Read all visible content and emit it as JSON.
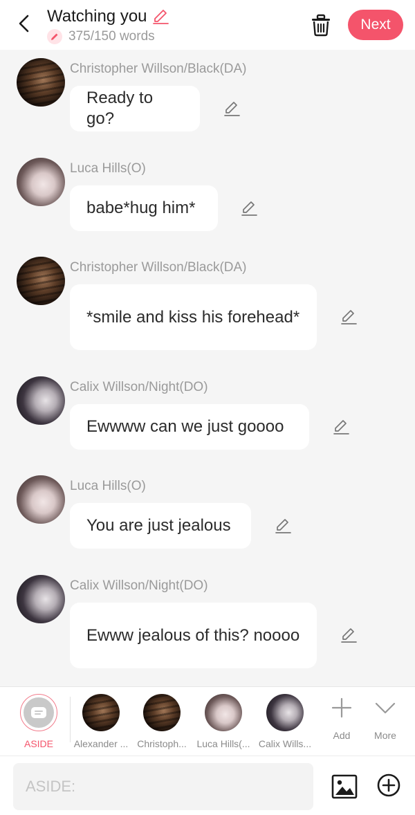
{
  "header": {
    "title": "Watching you",
    "word_count": "375/150 words",
    "next_label": "Next",
    "accent_color": "#f4546b"
  },
  "messages": [
    {
      "name": "Christopher Willson/Black(DA)",
      "text": "Ready to go?",
      "avatar": "christopher"
    },
    {
      "name": "Luca Hills(O)",
      "text": "babe*hug him*",
      "avatar": "luca"
    },
    {
      "name": "Christopher Willson/Black(DA)",
      "text": "*smile and kiss his forehead*",
      "avatar": "christopher"
    },
    {
      "name": "Calix Willson/Night(DO)",
      "text": "Ewwww can we just goooo",
      "avatar": "calix"
    },
    {
      "name": "Luca Hills(O)",
      "text": "You are just jealous",
      "avatar": "luca"
    },
    {
      "name": "Calix Willson/Night(DO)",
      "text": "Ewww jealous of this? noooo",
      "avatar": "calix"
    }
  ],
  "characters": [
    {
      "label": "ASIDE",
      "selected": true
    },
    {
      "label": "Alexander ..."
    },
    {
      "label": "Christoph..."
    },
    {
      "label": "Luca Hills(..."
    },
    {
      "label": "Calix Wills..."
    }
  ],
  "tools": {
    "add_label": "Add",
    "more_label": "More"
  },
  "input": {
    "placeholder": "ASIDE:"
  }
}
